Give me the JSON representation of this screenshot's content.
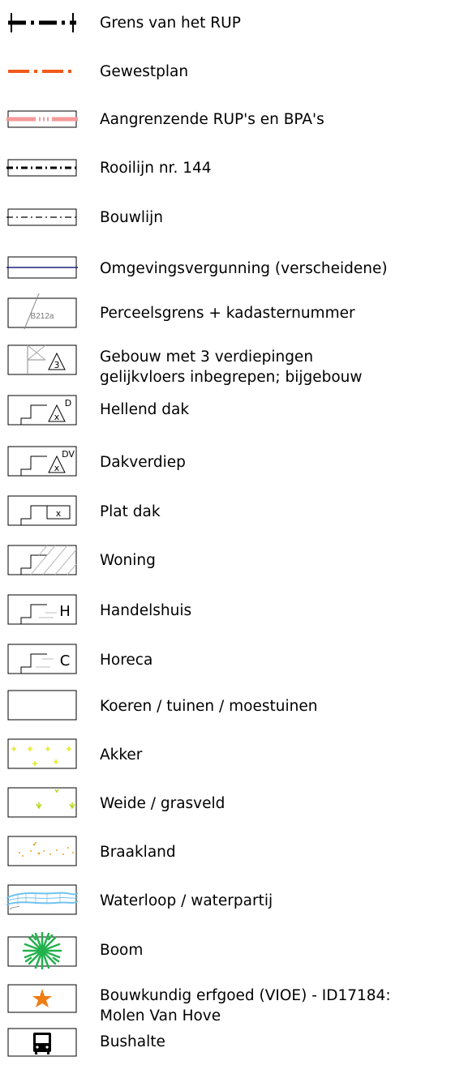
{
  "legend": [
    {
      "symbol": "rup-boundary-line",
      "label": "Grens van het RUP"
    },
    {
      "symbol": "gewestplan-line",
      "label": "Gewestplan"
    },
    {
      "symbol": "adjacent-plans-line",
      "label": "Aangrenzende RUP's en BPA's"
    },
    {
      "symbol": "rooilijn-line",
      "label": "Rooilijn nr. 144"
    },
    {
      "symbol": "bouwlijn-line",
      "label": "Bouwlijn"
    },
    {
      "symbol": "permit-line",
      "label": "Omgevingsvergunning (verscheidene)"
    },
    {
      "symbol": "parcel-boundary-box",
      "label": "Perceelsgrens + kadasternummer",
      "parcel_code": "B212a"
    },
    {
      "symbol": "building-floors-box",
      "label_lines": [
        "Gebouw met 3 verdiepingen",
        "gelijkvloers inbegrepen; bijgebouw"
      ],
      "floor_count": "3"
    },
    {
      "symbol": "sloped-roof-box",
      "label": "Hellend dak",
      "mark": "x",
      "sup": "D"
    },
    {
      "symbol": "roof-floor-box",
      "label": "Dakverdiep",
      "mark": "x",
      "sup": "DV"
    },
    {
      "symbol": "flat-roof-box",
      "label": "Plat dak",
      "mark": "x"
    },
    {
      "symbol": "dwelling-box",
      "label": "Woning"
    },
    {
      "symbol": "shop-box",
      "label": "Handelshuis",
      "letter": "H"
    },
    {
      "symbol": "horeca-box",
      "label": "Horeca",
      "letter": "C"
    },
    {
      "symbol": "garden-box",
      "label": "Koeren / tuinen / moestuinen"
    },
    {
      "symbol": "field-box",
      "label": "Akker"
    },
    {
      "symbol": "meadow-box",
      "label": "Weide / grasveld"
    },
    {
      "symbol": "fallow-box",
      "label": "Braakland"
    },
    {
      "symbol": "water-box",
      "label": "Waterloop / waterpartij"
    },
    {
      "symbol": "tree-box",
      "label": "Boom"
    },
    {
      "symbol": "heritage-star-box",
      "label_lines": [
        "Bouwkundig erfgoed (VIOE) - ID17184:",
        "Molen Van Hove"
      ]
    },
    {
      "symbol": "bus-stop-box",
      "label": "Bushalte"
    }
  ],
  "colors": {
    "gewestplan": "#f05a1a",
    "adjacent": "#f59a9a",
    "permit": "#1a237e",
    "field": "#e4e81c",
    "meadow": "#b6d81c",
    "fallow": "#e8a32a",
    "water": "#6fc3ef",
    "tree": "#22b14c",
    "heritage": "#f07d14"
  }
}
